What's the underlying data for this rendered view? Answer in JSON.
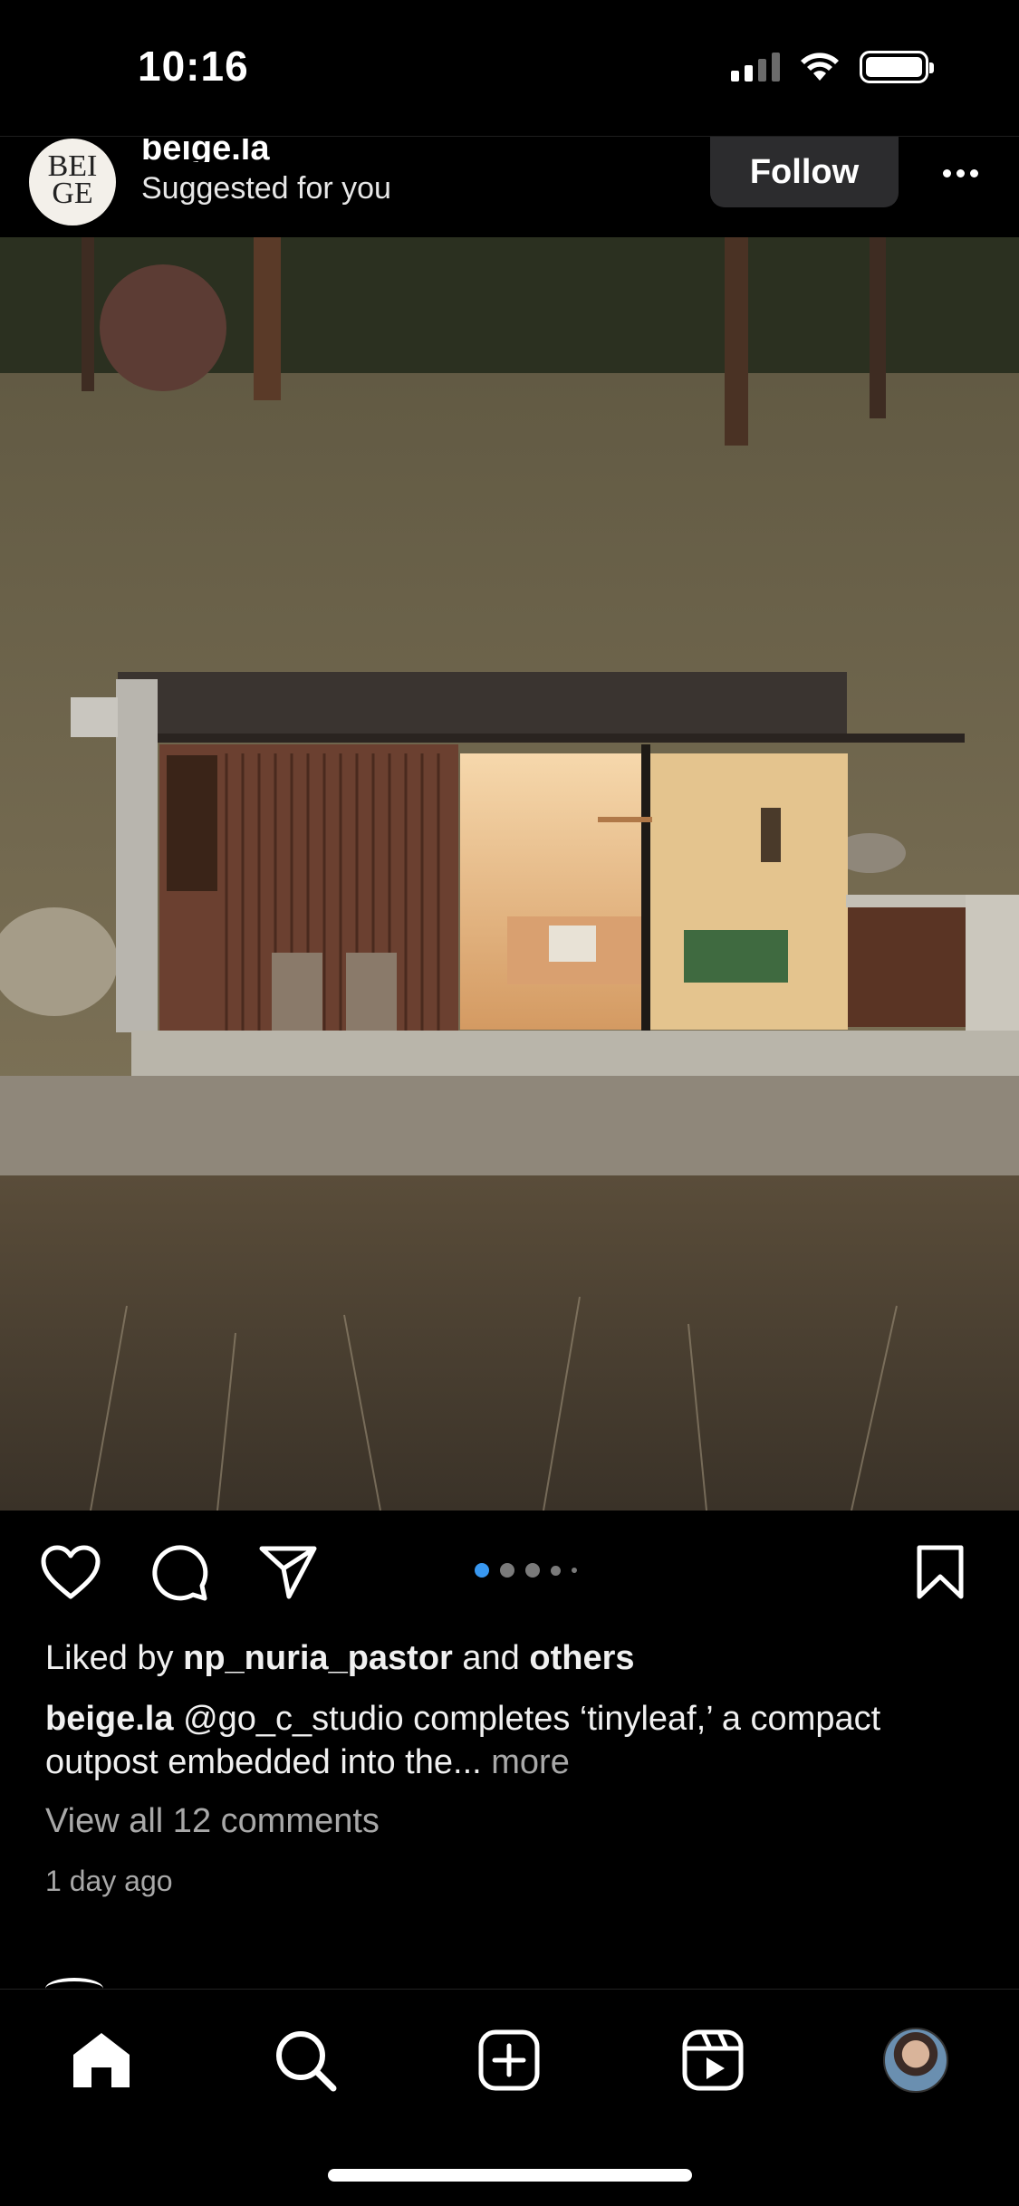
{
  "status_bar": {
    "time": "10:16"
  },
  "post": {
    "account": {
      "username": "beige.la",
      "avatar_text": "BEI GE",
      "subtitle": "Suggested for you"
    },
    "follow_label": "Follow",
    "carousel": {
      "total": 5,
      "active_index": 0
    },
    "likes": {
      "prefix": "Liked by",
      "user": "np_nuria_pastor",
      "joiner": "and",
      "others": "others"
    },
    "caption": {
      "username": "beige.la",
      "text": "@go_c_studio completes ‘tinyleaf,’ a compact outpost embedded into the...",
      "more": "more"
    },
    "comments_link": "View all 12 comments",
    "time_ago": "1 day ago"
  },
  "tab_bar": {
    "items": [
      "home",
      "search",
      "create",
      "reels",
      "profile"
    ],
    "active": "home"
  },
  "colors": {
    "background": "#000000",
    "accent_dot": "#3897f0",
    "muted_text": "#a8a8a8"
  }
}
